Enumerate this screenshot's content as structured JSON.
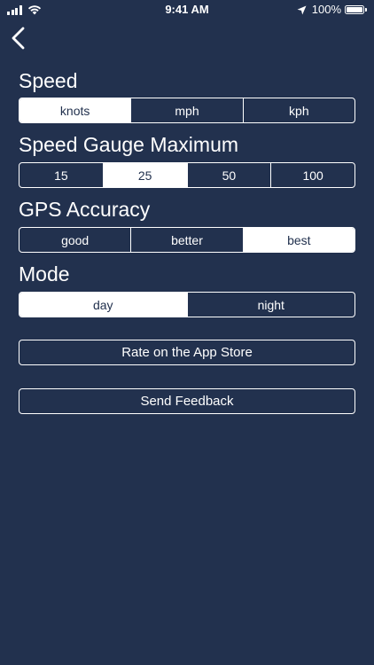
{
  "status_bar": {
    "time": "9:41 AM",
    "battery": "100%",
    "battery_level": 1.0,
    "signal_icon": "cellular-signal-icon",
    "wifi_icon": "wifi-icon",
    "location_icon": "location-arrow-icon"
  },
  "nav": {
    "back_icon": "chevron-left-icon"
  },
  "speed": {
    "title": "Speed",
    "options": [
      "knots",
      "mph",
      "kph"
    ],
    "selected": "knots"
  },
  "gauge_max": {
    "title": "Speed Gauge Maximum",
    "options": [
      "15",
      "25",
      "50",
      "100"
    ],
    "selected": "25"
  },
  "gps_accuracy": {
    "title": "GPS Accuracy",
    "options": [
      "good",
      "better",
      "best"
    ],
    "selected": "best"
  },
  "mode": {
    "title": "Mode",
    "options": [
      "day",
      "night"
    ],
    "selected": "day"
  },
  "buttons": {
    "rate": "Rate on the App Store",
    "feedback": "Send Feedback"
  },
  "colors": {
    "background": "#22314e",
    "foreground": "#ffffff"
  }
}
